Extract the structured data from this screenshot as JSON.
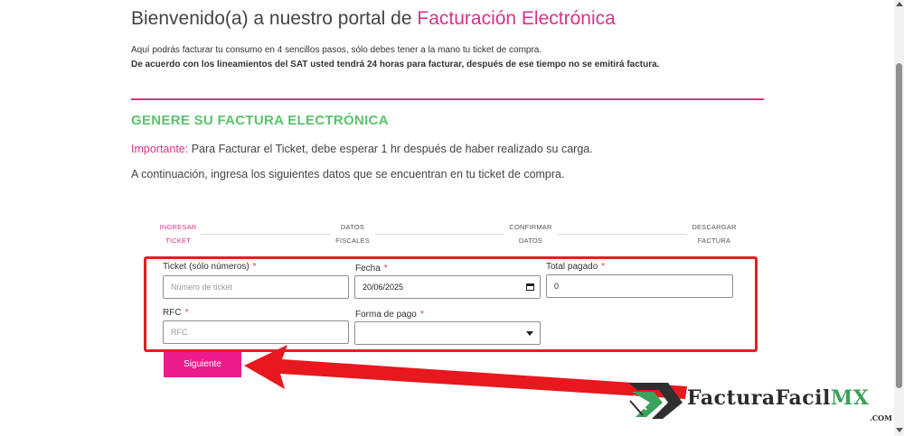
{
  "header": {
    "title_prefix": "Bienvenido(a) a nuestro portal de ",
    "title_accent": "Facturación Electrónica",
    "intro_line1": "Aquí podrás facturar tu consumo en 4 sencillos pasos, sólo debes tener a la mano tu ticket de compra.",
    "intro_line2": "De acuerdo con los lineamientos del SAT usted tendrá 24 horas para facturar, después de ese tiempo no se emitirá factura."
  },
  "section": {
    "title": "GENERE SU FACTURA ELECTRÓNICA",
    "important_label": "Importante:",
    "important_text": " Para Facturar el Ticket, debe esperar 1 hr después de haber realizado su carga.",
    "instructions": "A continuación, ingresa los siguientes datos que se encuentran en tu ticket de compra."
  },
  "steps": [
    {
      "line1": "INGRESAR",
      "line2": "TICKET",
      "active": true
    },
    {
      "line1": "DATOS",
      "line2": "FISCALES",
      "active": false
    },
    {
      "line1": "CONFIRMAR",
      "line2": "DATOS",
      "active": false
    },
    {
      "line1": "DESCARGAR",
      "line2": "FACTURA",
      "active": false
    }
  ],
  "form": {
    "ticket": {
      "label": "Ticket (sólo números)",
      "required": "*",
      "placeholder": "Número de ticket",
      "value": ""
    },
    "fecha": {
      "label": "Fecha",
      "required": "*",
      "value": "20/06/2025"
    },
    "total": {
      "label": "Total pagado",
      "required": "*",
      "value": "0"
    },
    "rfc": {
      "label": "RFC",
      "required": "*",
      "placeholder": "RFC",
      "value": ""
    },
    "forma_pago": {
      "label": "Forma de pago",
      "required": "*",
      "selected": ""
    }
  },
  "submit_label": "Siguiente",
  "logo": {
    "text_main": "FacturaFacil",
    "text_accent": "MX",
    "text_suffix": ".COM"
  },
  "colors": {
    "brand_pink": "#ec1c8c",
    "accent_green": "#5cc26e",
    "highlight_red": "#e02020"
  },
  "icons": [
    "calendar-icon",
    "chevron-down-icon",
    "arrow-annotation-icon",
    "logo-mark-icon"
  ]
}
